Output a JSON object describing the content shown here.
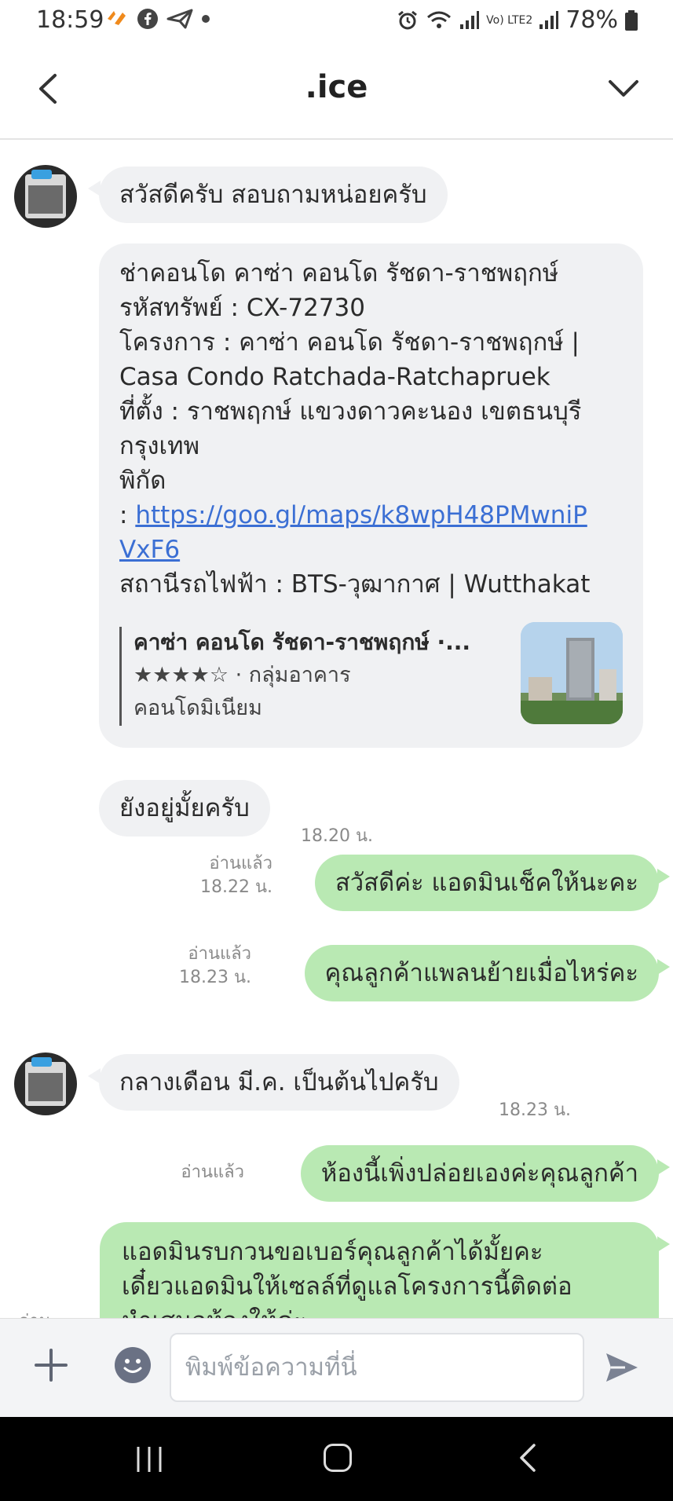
{
  "status_bar": {
    "time": "18:59",
    "battery": "78%",
    "network": "Vo) LTE2"
  },
  "header": {
    "title": ".ice"
  },
  "messages": {
    "m1": {
      "text": "สวัสดีครับ สอบถามหน่อยครับ"
    },
    "m2": {
      "line1": "ช่าคอนโด คาซ่า คอนโด รัชดา-ราชพฤกษ์",
      "line2": "รหัสทรัพย์ : CX-72730",
      "line3": "โครงการ : คาซ่า คอนโด รัชดา-ราชพฤกษ์ |",
      "line4": "Casa Condo Ratchada-Ratchapruek",
      "line5": "ที่ตั้ง : ราชพฤกษ์ แขวงดาวคะนอง เขตธนบุรี",
      "line6": "กรุงเทพ",
      "line7": "พิกัด",
      "link_prefix": ": ",
      "link_part1": "https://goo.gl/maps/k8wpH48PMwniP",
      "link_part2": "VxF6",
      "line9": "สถานีรถไฟฟ้า : BTS-วุฒากาศ | Wutthakat",
      "preview": {
        "title": "คาซ่า คอนโด รัชดา-ราชพฤกษ์ ·...",
        "stars": "★★★★☆",
        "category": "· กลุ่มอาคาร",
        "category2": "คอนโดมิเนียม"
      }
    },
    "m3": {
      "text": "ยังอยู่มั้ยครับ",
      "time": "18.20 น."
    },
    "m4": {
      "text": "สวัสดีค่ะ แอดมินเช็คให้นะคะ",
      "read": "อ่านแล้ว",
      "time": "18.22 น."
    },
    "m5": {
      "text": "คุณลูกค้าแพลนย้ายเมื่อไหร่คะ",
      "read": "อ่านแล้ว",
      "time": "18.23 น."
    },
    "m6": {
      "text": "กลางเดือน มี.ค. เป็นต้นไปครับ",
      "time": "18.23 น."
    },
    "m7": {
      "text": "ห้องนี้เพิ่งปล่อยเองค่ะคุณลูกค้า",
      "read": "อ่านแล้ว"
    },
    "m8": {
      "line1": "แอดมินรบกวนขอเบอร์คุณลูกค้าได้มั้ยคะ",
      "line2": "เดี๋ยวแอดมินให้เซลล์ที่ดูแลโครงการนี้ติดต่อ",
      "line3": "นำเสนอห้องให้ค่ะ",
      "read": "อ่านแล้ว"
    }
  },
  "composer": {
    "placeholder": "พิมพ์ข้อความที่นี่"
  }
}
